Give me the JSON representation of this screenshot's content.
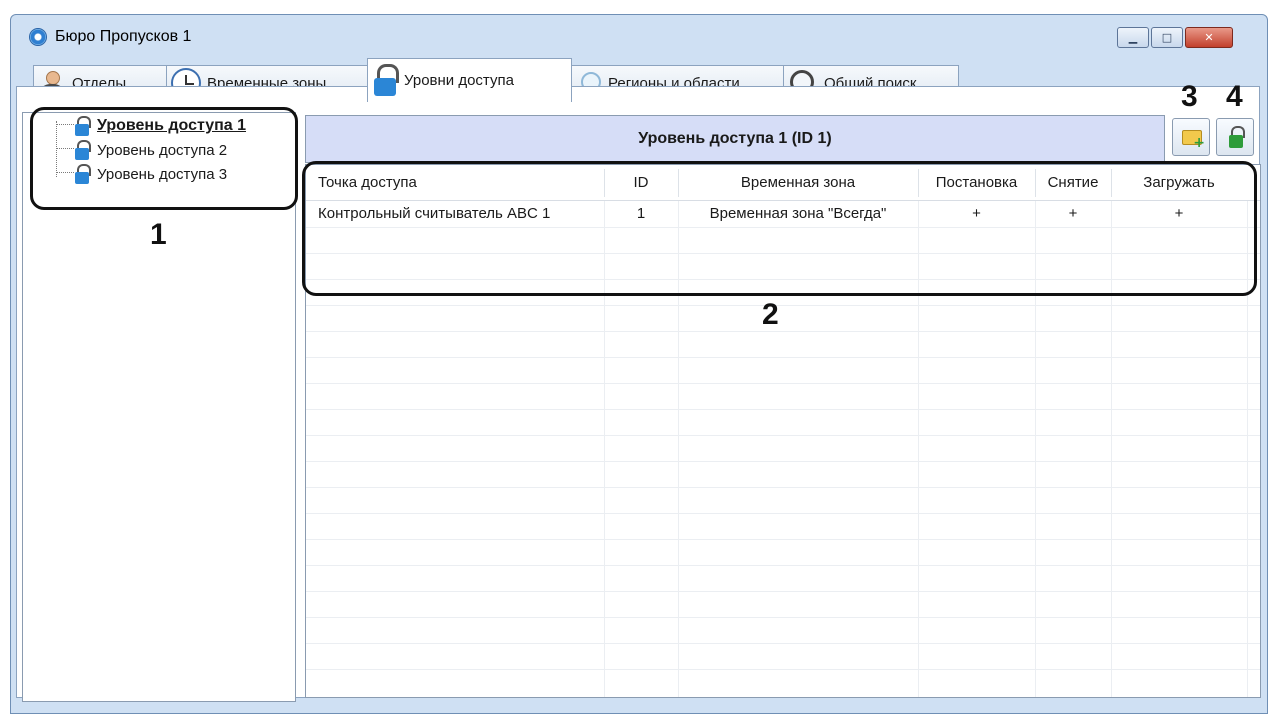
{
  "window": {
    "title": "Бюро Пропусков 1",
    "controls": {
      "minimize": "▁",
      "maximize": "□",
      "close": "✕"
    }
  },
  "tabs": [
    {
      "label": "Отделы",
      "icon": "user-icon"
    },
    {
      "label": "Временные зоны",
      "icon": "clock-icon"
    },
    {
      "label": "Уровни доступа",
      "icon": "lock-icon",
      "active": true
    },
    {
      "label": "Регионы и области",
      "icon": "region-icon"
    },
    {
      "label": "Общий поиск",
      "icon": "search-icon"
    }
  ],
  "tree": {
    "items": [
      {
        "label": "Уровень доступа 1",
        "selected": true
      },
      {
        "label": "Уровень доступа 2"
      },
      {
        "label": "Уровень доступа 3"
      }
    ]
  },
  "panel": {
    "header": "Уровень доступа 1 (ID 1)",
    "buttons": {
      "add_folder_icon": "folder-add-icon",
      "add_lock_icon": "lock-add-icon"
    }
  },
  "table": {
    "columns": [
      "Точка доступа",
      "ID",
      "Временная зона",
      "Постановка",
      "Снятие",
      "Загружать"
    ],
    "rows": [
      [
        "Контрольный считыватель ABC 1",
        "1",
        "Временная зона \"Всегда\"",
        "+",
        "+",
        "+"
      ]
    ]
  },
  "callouts": [
    "1",
    "2",
    "3",
    "4"
  ],
  "colors": {
    "window_frame": "#cfe0f3",
    "panel_header": "#d6ddf7",
    "lock_blue": "#2b86d6",
    "add_green": "#2e9c3a"
  }
}
